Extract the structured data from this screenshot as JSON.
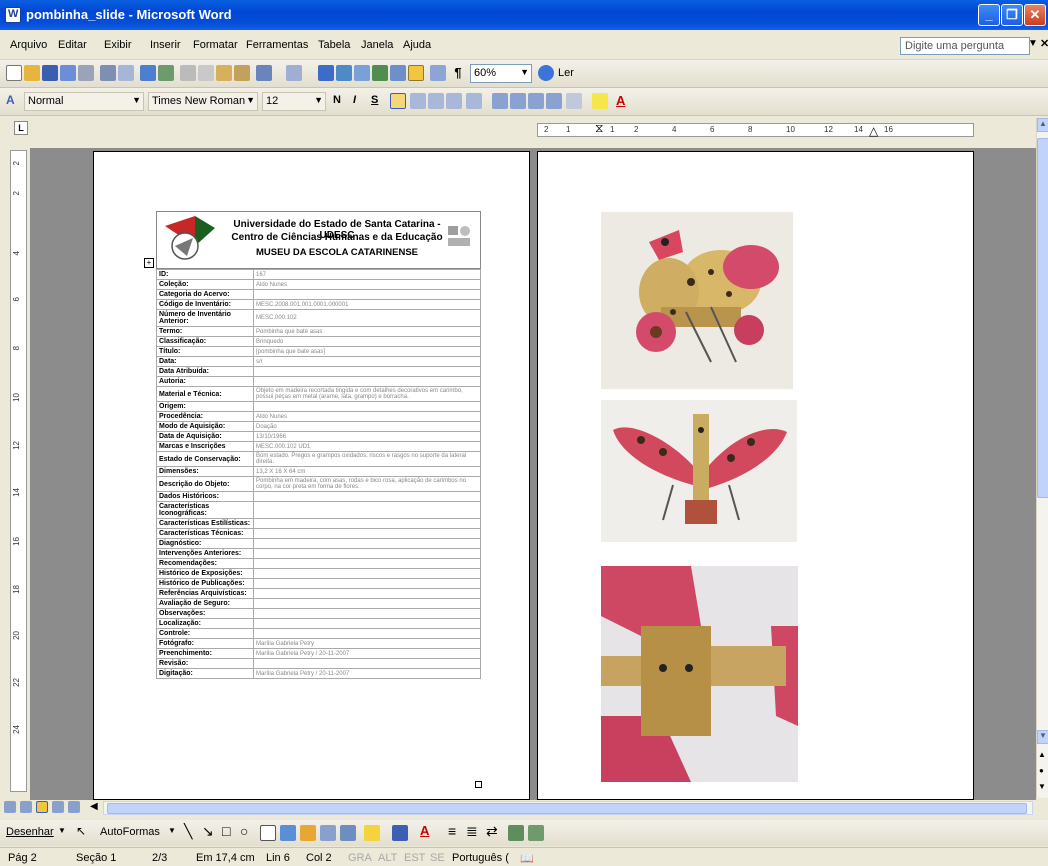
{
  "window": {
    "title": "pombinha_slide - Microsoft Word"
  },
  "menu": {
    "items": [
      "Arquivo",
      "Editar",
      "Exibir",
      "Inserir",
      "Formatar",
      "Ferramentas",
      "Tabela",
      "Janela",
      "Ajuda"
    ],
    "help_placeholder": "Digite uma pergunta"
  },
  "toolbar": {
    "zoom": "60%",
    "read_label": "Ler"
  },
  "formatting": {
    "style": "Normal",
    "font": "Times New Roman",
    "size": "12",
    "bold": "N",
    "italic": "I",
    "underline": "S"
  },
  "ruler": {
    "h_numbers": [
      "2",
      "1",
      "1",
      "2",
      "4",
      "6",
      "8",
      "10",
      "12",
      "14",
      "16"
    ],
    "v_numbers": [
      "2",
      "2",
      "4",
      "6",
      "8",
      "10",
      "12",
      "14",
      "16",
      "18",
      "20",
      "22",
      "24"
    ]
  },
  "record": {
    "header_line1": "Universidade do Estado de Santa Catarina - UDESC",
    "header_line2": "Centro de Ciências Humanas e da Educação",
    "header_line3": "MUSEU DA ESCOLA CATARINENSE",
    "rows": [
      {
        "label": "ID:",
        "value": "167"
      },
      {
        "label": "Coleção:",
        "value": "Aldo Nunes"
      },
      {
        "label": "Categoria do Acervo:",
        "value": ""
      },
      {
        "label": "Código de Inventário:",
        "value": "MESC.2008.001.001.0001.000001"
      },
      {
        "label": "Número de Inventário Anterior:",
        "value": "MESC.000.102"
      },
      {
        "label": "Termo:",
        "value": "Pombinha que bate asas"
      },
      {
        "label": "Classificação:",
        "value": "Brinquedo"
      },
      {
        "label": "Título:",
        "value": "[pombinha que bate asas]"
      },
      {
        "label": "Data:",
        "value": "s/r"
      },
      {
        "label": "Data Atribuída:",
        "value": ""
      },
      {
        "label": "Autoria:",
        "value": ""
      },
      {
        "label": "Material e Técnica:",
        "value": "Objeto em madeira recortada tingida e com detalhes decorativos em carimbo, possui peças em metal (arame, lata, grampo) e borracha."
      },
      {
        "label": "Origem:",
        "value": ""
      },
      {
        "label": "Procedência:",
        "value": "Aldo Nunes"
      },
      {
        "label": "Modo de Aquisição:",
        "value": "Doação"
      },
      {
        "label": "Data de Aquisição:",
        "value": "13/10/1966"
      },
      {
        "label": "Marcas e Inscrições",
        "value": "MESC.000.102 UD1"
      },
      {
        "label": "Estado de Conservação:",
        "value": "Bom estado. Pregos e grampos oxidados, riscos e rasgos no suporte da lateral direita."
      },
      {
        "label": "Dimensões:",
        "value": "13,2 X 16 X 64 cm"
      },
      {
        "label": "Descrição do Objeto:",
        "value": "Pombinha em madeira, com asas, rodas e bico rosa, aplicação de carimbos no corpo, na cor preta em forma de flores."
      },
      {
        "label": "Dados Históricos:",
        "value": ""
      },
      {
        "label": "Características Iconográficas:",
        "value": ""
      },
      {
        "label": "Características Estilísticas:",
        "value": ""
      },
      {
        "label": "Características Técnicas:",
        "value": ""
      },
      {
        "label": "Diagnóstico:",
        "value": ""
      },
      {
        "label": "Intervenções Anteriores:",
        "value": ""
      },
      {
        "label": "Recomendações:",
        "value": ""
      },
      {
        "label": "Histórico de Exposições:",
        "value": ""
      },
      {
        "label": "Histórico de Publicações:",
        "value": ""
      },
      {
        "label": "Referências Arquivísticas:",
        "value": ""
      },
      {
        "label": "Avaliação de Seguro:",
        "value": ""
      },
      {
        "label": "Observações:",
        "value": ""
      },
      {
        "label": "Localização:",
        "value": ""
      },
      {
        "label": "Controle:",
        "value": ""
      },
      {
        "label": "Fotógrafo:",
        "value": "Marília Gabriela Petry"
      },
      {
        "label": "Preenchimento:",
        "value": "Marília Gabriela Petry / 20-11-2007"
      },
      {
        "label": "Revisão:",
        "value": ""
      },
      {
        "label": "Digitação:",
        "value": "Marília Gabriela Petry / 20-11-2007"
      }
    ]
  },
  "drawing": {
    "draw_label": "Desenhar",
    "autoshapes_label": "AutoFormas"
  },
  "status": {
    "page": "Pág 2",
    "section": "Seção 1",
    "pages": "2/3",
    "position": "Em 17,4 cm",
    "line": "Lin 6",
    "col": "Col 2",
    "rec": "GRA",
    "trk": "ALT",
    "ext": "EST",
    "ovr": "SE",
    "language": "Português ("
  }
}
